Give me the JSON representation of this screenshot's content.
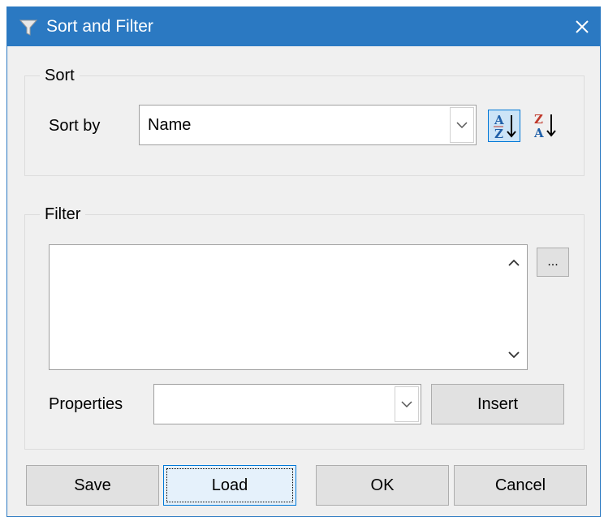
{
  "window": {
    "title": "Sort and Filter",
    "close_glyph": "✕",
    "title_icon": "funnel-icon"
  },
  "sort": {
    "group_label": "Sort",
    "sort_by_label": "Sort by",
    "sort_by_value": "Name",
    "ascending_icon": "sort-ascending-icon",
    "descending_icon": "sort-descending-icon",
    "asc_top": "A",
    "asc_bottom": "Z",
    "desc_top": "Z",
    "desc_bottom": "A"
  },
  "filter": {
    "group_label": "Filter",
    "expression": "",
    "ellipsis_label": "...",
    "properties_label": "Properties",
    "properties_value": "",
    "insert_label": "Insert"
  },
  "buttons": {
    "save": "Save",
    "load": "Load",
    "ok": "OK",
    "cancel": "Cancel"
  },
  "colors": {
    "titlebar": "#2b79c2",
    "accent": "#0078d7",
    "dialog_bg": "#f0f0f0"
  }
}
